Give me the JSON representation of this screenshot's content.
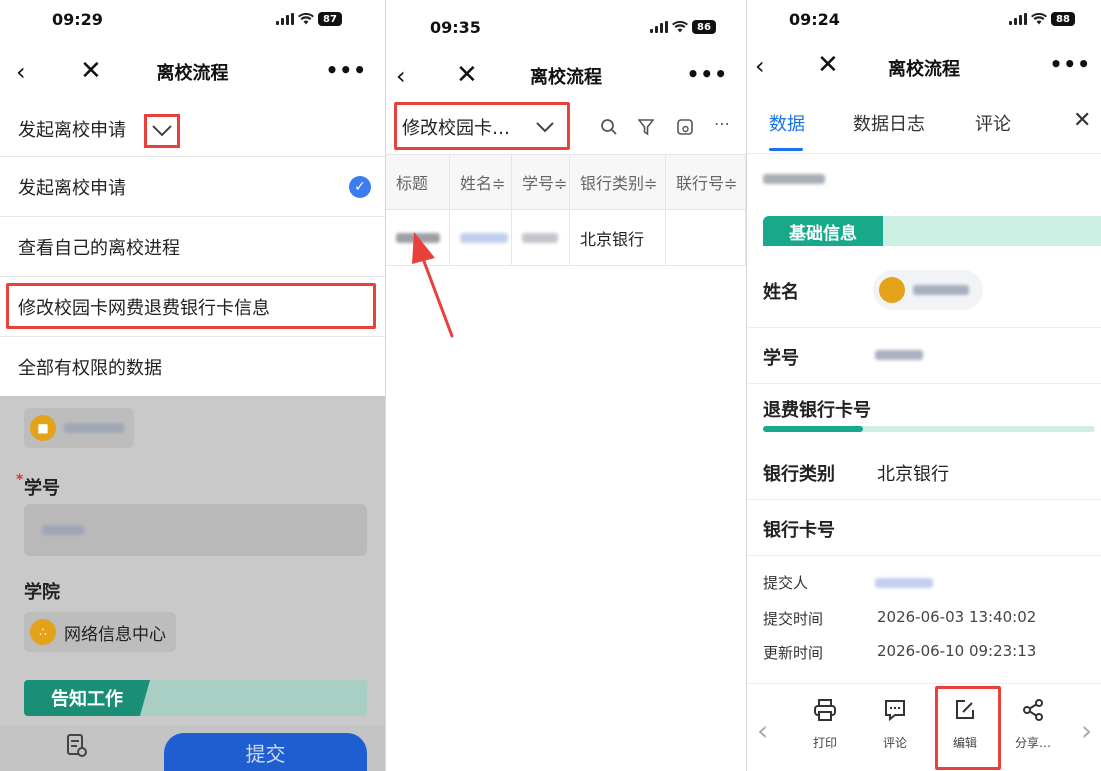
{
  "p1": {
    "time": "09:29",
    "battery": "87",
    "title": "离校流程",
    "dropdown_label": "发起离校申请",
    "menu": [
      "发起离校申请",
      "查看自己的离校进程",
      "修改校园卡网费退费银行卡信息",
      "全部有权限的数据"
    ],
    "form": {
      "student_id_label": "学号",
      "required_mark": "*",
      "college_label": "学院",
      "college_value": "网络信息中心",
      "section": "告知工作",
      "submit": "提交"
    }
  },
  "p2": {
    "time": "09:35",
    "battery": "86",
    "title": "离校流程",
    "view_label": "修改校园卡…",
    "columns": [
      "标题",
      "姓名≑",
      "学号≑",
      "银行类别≑",
      "联行号≑"
    ],
    "row": {
      "bank": "北京银行"
    }
  },
  "p3": {
    "time": "09:24",
    "battery": "88",
    "title": "离校流程",
    "tabs": [
      "数据",
      "数据日志",
      "评论"
    ],
    "section_basic": "基础信息",
    "name_label": "姓名",
    "student_id_label": "学号",
    "refund_card_label": "退费银行卡号",
    "bank_type_label": "银行类别",
    "bank_type_value": "北京银行",
    "card_no_label": "银行卡号",
    "submitter_label": "提交人",
    "submit_time_label": "提交时间",
    "submit_time_value": "2026-06-03 13:40:02",
    "update_time_label": "更新时间",
    "update_time_value": "2026-06-10 09:23:13",
    "actions": [
      "打印",
      "评论",
      "编辑",
      "分享…"
    ],
    "refund_progress": 0.3
  },
  "colors": {
    "accent_blue": "#1a73e8",
    "highlight_red": "#e8413b",
    "teal": "#17a98a",
    "submit_blue": "#1e5ed0"
  },
  "icons": {
    "back": "chevron-left-icon",
    "close": "close-icon",
    "more": "more-icon",
    "check": "check-icon",
    "search": "search-icon",
    "filter": "filter-icon",
    "note": "note-icon",
    "print": "print-icon",
    "comment": "comment-icon",
    "edit": "edit-icon",
    "share": "share-icon"
  }
}
